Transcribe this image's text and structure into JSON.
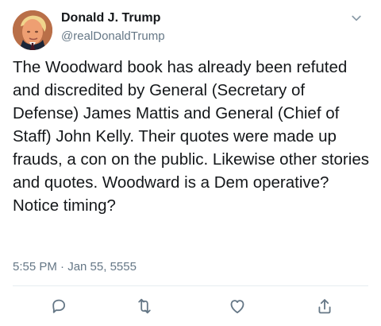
{
  "tweet": {
    "author": {
      "display_name": "Donald J. Trump",
      "handle": "@realDonaldTrump"
    },
    "body": "The Woodward book has already been refuted and discredited by General (Secretary of Defense) James Mattis and General (Chief of Staff) John Kelly. Their quotes were made up frauds, a con on the public. Likewise other stories and quotes. Woodward is a Dem operative? Notice timing?",
    "timestamp": "5:55 PM · Jan 55, 5555"
  },
  "icons": {
    "menu": "chevron-down-icon",
    "reply": "reply-icon",
    "retweet": "retweet-icon",
    "like": "heart-icon",
    "share": "share-icon"
  },
  "colors": {
    "text": "#14171a",
    "secondary_text": "#657786",
    "divider": "#e6ecf0",
    "action_icon": "#657786"
  }
}
